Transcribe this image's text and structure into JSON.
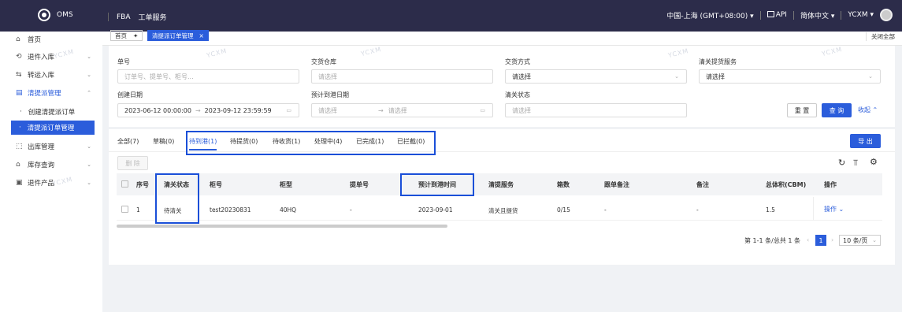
{
  "topbar": {
    "app_name": "OMS",
    "nav": [
      "FBA",
      "工单服务"
    ],
    "timezone": "中国-上海 (GMT+08:00)",
    "api_label": "API",
    "language": "简体中文",
    "user": "YCXM"
  },
  "sidebar": {
    "items": [
      {
        "label": "首页",
        "icon": "home-icon"
      },
      {
        "label": "退件入库",
        "icon": "return-icon"
      },
      {
        "label": "转运入库",
        "icon": "transfer-icon"
      },
      {
        "label": "清提派管理",
        "icon": "document-icon"
      },
      {
        "label": "出库管理",
        "icon": "outbound-icon"
      },
      {
        "label": "库存查询",
        "icon": "warehouse-icon"
      },
      {
        "label": "退件产品",
        "icon": "product-icon"
      }
    ],
    "sub_items": [
      "创建清提派订单",
      "清提派订单管理"
    ]
  },
  "tabstrip": {
    "home": "首页",
    "active": "清提派订单管理",
    "close_all": "关闭全部"
  },
  "filter": {
    "order_no_label": "单号",
    "order_no_placeholder": "订单号、提单号、柜号...",
    "warehouse_label": "交货仓库",
    "warehouse_placeholder": "请选择",
    "delivery_label": "交货方式",
    "delivery_value": "请选择",
    "service_label": "清关提货服务",
    "service_value": "请选择",
    "created_label": "创建日期",
    "created_start": "2023-06-12 00:00:00",
    "created_sep": "→",
    "created_end": "2023-09-12 23:59:59",
    "eta_label": "预计到港日期",
    "eta_start": "请选择",
    "eta_sep": "→",
    "eta_end": "请选择",
    "customs_label": "清关状态",
    "customs_placeholder": "请选择",
    "reset_label": "重 置",
    "search_label": "查 询",
    "collapse_label": "收起"
  },
  "watermark": "YCXM",
  "status_tabs": [
    "全部(7)",
    "草稿(0)",
    "待到港(1)",
    "待提货(0)",
    "待收货(1)",
    "处理中(4)",
    "已完成(1)",
    "已拦截(0)"
  ],
  "export_label": "导 出",
  "delete_label": "删 除",
  "table": {
    "headers": [
      "序号",
      "清关状态",
      "柜号",
      "柜型",
      "提单号",
      "预计到港时间",
      "清提服务",
      "箱数",
      "跟单备注",
      "备注",
      "总体积(CBM)",
      "操作"
    ],
    "rows": [
      [
        "1",
        "待清关",
        "test20230831",
        "40HQ",
        "-",
        "2023-09-01",
        "清关且提货",
        "0/15",
        "-",
        "-",
        "1.5",
        "操作"
      ]
    ]
  },
  "pagination": {
    "summary": "第 1-1 条/总共 1 条",
    "current": "1",
    "page_size": "10 条/页"
  },
  "colors": {
    "topbar": "#2c2c4a",
    "accent": "#2b5ddb",
    "highlight": "#1a4fd8"
  }
}
